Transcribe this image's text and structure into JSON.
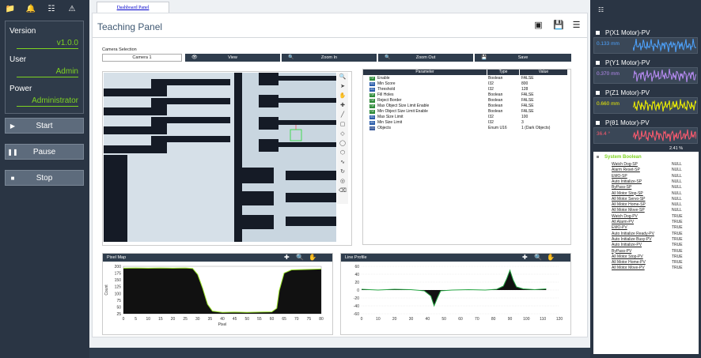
{
  "left": {
    "icons": [
      "folder-icon",
      "bell-icon",
      "robot-icon",
      "warning-icon"
    ],
    "version_label": "Version",
    "version_value": "v1.0.0",
    "user_label": "User",
    "user_value": "Admin",
    "power_label": "Power",
    "power_value": "Administrator",
    "start_label": "Start",
    "pause_label": "Pause",
    "stop_label": "Stop"
  },
  "main": {
    "tab_label": "Dashboard Panel",
    "title": "Teaching Panel",
    "camera_label": "Camera Selection",
    "camera_value": "Camera 1",
    "view_label": "View",
    "zoom_in_label": "Zoom In",
    "zoom_out_label": "Zoom Out",
    "save_label": "Save"
  },
  "params": {
    "headers": [
      "Parameter",
      "Type",
      "Value"
    ],
    "rows": [
      {
        "icon": "T/F",
        "name": "Enable",
        "type": "Boolean",
        "value": "FALSE"
      },
      {
        "icon": "0/1",
        "name": "Min Score",
        "type": "I32",
        "value": "800"
      },
      {
        "icon": "0/1",
        "name": "Threshold",
        "type": "I32",
        "value": "128"
      },
      {
        "icon": "T/F",
        "name": "Fill Holes",
        "type": "Boolean",
        "value": "FALSE"
      },
      {
        "icon": "T/F",
        "name": "Reject Border",
        "type": "Boolean",
        "value": "FALSE"
      },
      {
        "icon": "T/F",
        "name": "Max Object Size Limit Enable",
        "type": "Boolean",
        "value": "FALSE"
      },
      {
        "icon": "T/F",
        "name": "Min Object Size Limit Enable",
        "type": "Boolean",
        "value": "FALSE"
      },
      {
        "icon": "0/1",
        "name": "Max Size Limit",
        "type": "I32",
        "value": "100"
      },
      {
        "icon": "0/1",
        "name": "Min Size Limit",
        "type": "I32",
        "value": "3"
      },
      {
        "icon": "===",
        "name": "Objects",
        "type": "Enum U16",
        "value": "1 (Dark Objects)"
      }
    ]
  },
  "pixel_map": {
    "title": "Pixel Map",
    "xlabel": "Pixel",
    "ylabel": "Count",
    "yticks": [
      "200",
      "175",
      "150",
      "125",
      "100",
      "75",
      "50",
      "25"
    ],
    "xticks": [
      "0",
      "5",
      "10",
      "15",
      "20",
      "25",
      "30",
      "35",
      "40",
      "45",
      "50",
      "55",
      "60",
      "65",
      "70",
      "75",
      "80"
    ]
  },
  "line_profile": {
    "title": "Line Profile",
    "yticks": [
      "60",
      "40",
      "20",
      "0",
      "-20",
      "-40",
      "-60"
    ],
    "xticks": [
      "0",
      "10",
      "20",
      "30",
      "40",
      "50",
      "60",
      "70",
      "80",
      "90",
      "100",
      "110",
      "120"
    ]
  },
  "motors": [
    {
      "label": "P(X1 Motor)-PV",
      "value": "0.133 mm",
      "color": "#4da3ff"
    },
    {
      "label": "P(Y1 Motor)-PV",
      "value": "0.370 mm",
      "color": "#b98cf5"
    },
    {
      "label": "P(Z1 Motor)-PV",
      "value": "0.660 mm",
      "color": "#f2f200"
    },
    {
      "label": "P(θ1 Motor)-PV",
      "value": "36.4 °",
      "color": "#ff5a6e"
    }
  ],
  "percent": "2.41 %",
  "system": {
    "title": "System Boolean",
    "rows": [
      {
        "name": "Watch Dog-SP",
        "value": "NULL"
      },
      {
        "name": "Alarm Reset-SP",
        "value": "NULL"
      },
      {
        "name": "EMO-SP",
        "value": "NULL"
      },
      {
        "name": "Auto Initialize-SP",
        "value": "NULL"
      },
      {
        "name": "ByPass-SP",
        "value": "NULL"
      },
      {
        "name": "All Motor Stop-SP",
        "value": "NULL"
      },
      {
        "name": "All Motor Servo-SP",
        "value": "NULL"
      },
      {
        "name": "All Motor Home-SP",
        "value": "NULL"
      },
      {
        "name": "All Motor Move-SP",
        "value": "NULL"
      },
      {
        "name": "Watch Dog-PV",
        "value": "TRUE"
      },
      {
        "name": "All Alarm-PV",
        "value": "TRUE"
      },
      {
        "name": "EMO-PV",
        "value": "TRUE"
      },
      {
        "name": "Auto Initialize Ready-PV",
        "value": "TRUE"
      },
      {
        "name": "Auto Initialize Busy-PV",
        "value": "TRUE"
      },
      {
        "name": "Auto Initialize-PV",
        "value": "TRUE"
      },
      {
        "name": "ByPass-PV",
        "value": "TRUE"
      },
      {
        "name": "All Motor Stop-PV",
        "value": "TRUE"
      },
      {
        "name": "All Motor Home-PV",
        "value": "TRUE"
      },
      {
        "name": "All Motor Move-PV",
        "value": "TRUE"
      }
    ]
  }
}
